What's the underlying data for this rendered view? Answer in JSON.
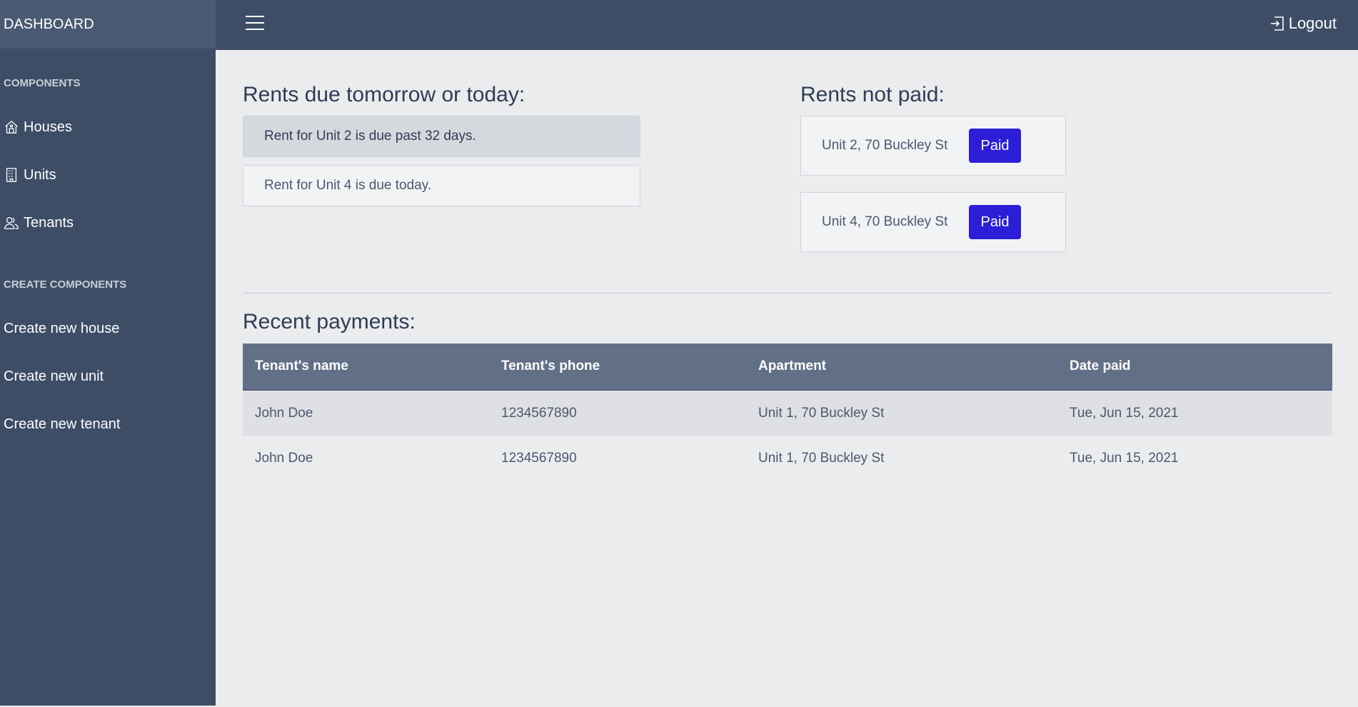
{
  "brand": "DASHBOARD",
  "sidebar": {
    "components_heading": "COMPONENTS",
    "components": [
      {
        "label": "Houses",
        "icon": "house-icon"
      },
      {
        "label": "Units",
        "icon": "building-icon"
      },
      {
        "label": "Tenants",
        "icon": "people-icon"
      }
    ],
    "create_heading": "CREATE COMPONENTS",
    "create": [
      {
        "label": "Create new house"
      },
      {
        "label": "Create new unit"
      },
      {
        "label": "Create new tenant"
      }
    ]
  },
  "topbar": {
    "menu_icon": "hamburger-icon",
    "logout_label": "Logout",
    "logout_icon": "logout-icon"
  },
  "due": {
    "title": "Rents due tomorrow or today:",
    "items": [
      "Rent for Unit 2 is due past 32 days.",
      "Rent for Unit 4 is due today."
    ]
  },
  "not_paid": {
    "title": "Rents not paid:",
    "items": [
      {
        "label": "Unit 2, 70 Buckley St",
        "button": "Paid"
      },
      {
        "label": "Unit 4, 70 Buckley St",
        "button": "Paid"
      }
    ]
  },
  "recent": {
    "title": "Recent payments:",
    "columns": [
      "Tenant's name",
      "Tenant's phone",
      "Apartment",
      "Date paid"
    ],
    "rows": [
      [
        "John Doe",
        "1234567890",
        "Unit 1, 70 Buckley St",
        "Tue, Jun 15, 2021"
      ],
      [
        "John Doe",
        "1234567890",
        "Unit 1, 70 Buckley St",
        "Tue, Jun 15, 2021"
      ]
    ]
  },
  "colors": {
    "sidebar_bg": "#3d4d66",
    "brand_bg": "#4a5a72",
    "paid_button": "#2c1ed6",
    "table_header": "#627087"
  }
}
